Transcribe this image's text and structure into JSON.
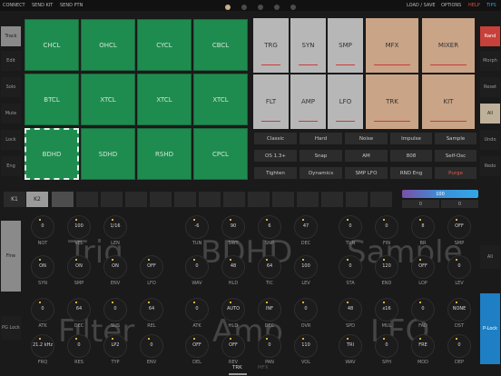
{
  "topbar": {
    "connect": "CONNECT",
    "send_kit": "SEND KIT",
    "send_ptn": "SEND PTN",
    "load_save": "LOAD / SAVE",
    "options": "OPTIONS",
    "help": "HELP",
    "tips": "TIPS",
    "page_dots": 5,
    "active_dot": 0
  },
  "left_panel": [
    "Track",
    "Edit",
    "Solo",
    "Mute",
    "Lock",
    "Eng"
  ],
  "right_panel": [
    "Rand",
    "Morph",
    "Reset",
    "All",
    "Undo",
    "Redo"
  ],
  "pads": [
    [
      "CHCL",
      "OHCL",
      "CYCL",
      "CBCL"
    ],
    [
      "BTCL",
      "XTCL",
      "XTCL",
      "XTCL"
    ],
    [
      "BDHD",
      "SDHD",
      "RSHD",
      "CPCL"
    ]
  ],
  "selected_pad": "BDHD",
  "pages_row1": [
    "TRG",
    "SYN",
    "SMP",
    "MFX",
    "MIXER"
  ],
  "pages_row2": [
    "FLT",
    "AMP",
    "LFO",
    "TRK",
    "KIT"
  ],
  "machines": [
    [
      "Classic",
      "Hard",
      "Noise",
      "Impulse",
      "Sample"
    ],
    [
      "OS 1.3+",
      "Snap",
      "AM",
      "808",
      "Self-Osc"
    ],
    [
      "Tighten",
      "Dynamics",
      "SMP LFO",
      "RND Eng",
      "Purge"
    ]
  ],
  "track_tabs": [
    "K1",
    "K2",
    "",
    "",
    "",
    "",
    "",
    "",
    "",
    "",
    "",
    "",
    "",
    "",
    "",
    ""
  ],
  "level_bar": {
    "value": "100",
    "left": "0",
    "right": "0"
  },
  "watermarks": {
    "trig": "Trig",
    "track": "BDHD",
    "sample": "Sample",
    "filter": "Filter",
    "amp": "Amp",
    "lfo": "LFO"
  },
  "side_buttons": {
    "fine": "Fine",
    "p_lock": "P-Lock",
    "all": "All",
    "pg_lock": "PG Lock"
  },
  "knobs": {
    "row1": [
      {
        "v": "0",
        "l": "NOT"
      },
      {
        "v": "100",
        "l": "VEL"
      },
      {
        "v": "1/16",
        "l": "LEN"
      },
      {
        "v": "-6",
        "l": "TUN"
      },
      {
        "v": "90",
        "l": "SWT"
      },
      {
        "v": "6",
        "l": "SNP"
      },
      {
        "v": "47",
        "l": "DEC"
      },
      {
        "v": "0",
        "l": "TUN"
      },
      {
        "v": "0",
        "l": "FIN"
      },
      {
        "v": "8",
        "l": "BR"
      },
      {
        "v": "OFF",
        "l": "SMP"
      }
    ],
    "row2": [
      {
        "v": "ON",
        "l": "SYN"
      },
      {
        "v": "ON",
        "l": "SMP"
      },
      {
        "v": "ON",
        "l": "ENV"
      },
      {
        "v": "OFF",
        "l": "LFO"
      },
      {
        "v": "0",
        "l": "WAV"
      },
      {
        "v": "48",
        "l": "HLD"
      },
      {
        "v": "64",
        "l": "TIC"
      },
      {
        "v": "100",
        "l": "LEV"
      },
      {
        "v": "0",
        "l": "STA"
      },
      {
        "v": "120",
        "l": "END"
      },
      {
        "v": "OFF",
        "l": "LOP"
      },
      {
        "v": "0",
        "l": "LEV"
      }
    ],
    "row3": [
      {
        "v": "0",
        "l": "ATK"
      },
      {
        "v": "64",
        "l": "DEC"
      },
      {
        "v": "0",
        "l": "SUS"
      },
      {
        "v": "64",
        "l": "REL"
      },
      {
        "v": "0",
        "l": "ATK"
      },
      {
        "v": "AUTO",
        "l": "HLD"
      },
      {
        "v": "INF",
        "l": "DEC"
      },
      {
        "v": "0",
        "l": "OVR"
      },
      {
        "v": "48",
        "l": "SPD"
      },
      {
        "v": "x16",
        "l": "MUL"
      },
      {
        "v": "0",
        "l": "FAD"
      },
      {
        "v": "NONE",
        "l": "DST"
      }
    ],
    "row4": [
      {
        "v": "21.2 kHz",
        "l": "FRQ"
      },
      {
        "v": "0",
        "l": "RES"
      },
      {
        "v": "LP2",
        "l": "TYP"
      },
      {
        "v": "0",
        "l": "ENV"
      },
      {
        "v": "OFF",
        "l": "DEL"
      },
      {
        "v": "OFF",
        "l": "REV"
      },
      {
        "v": "0",
        "l": "PAN"
      },
      {
        "v": "110",
        "l": "VOL"
      },
      {
        "v": "TRI",
        "l": "WAV"
      },
      {
        "v": "0",
        "l": "SPH"
      },
      {
        "v": "FRE",
        "l": "MOD"
      },
      {
        "v": "0",
        "l": "DEP"
      }
    ]
  },
  "bottom_tabs": [
    "TRK",
    "MFX"
  ]
}
